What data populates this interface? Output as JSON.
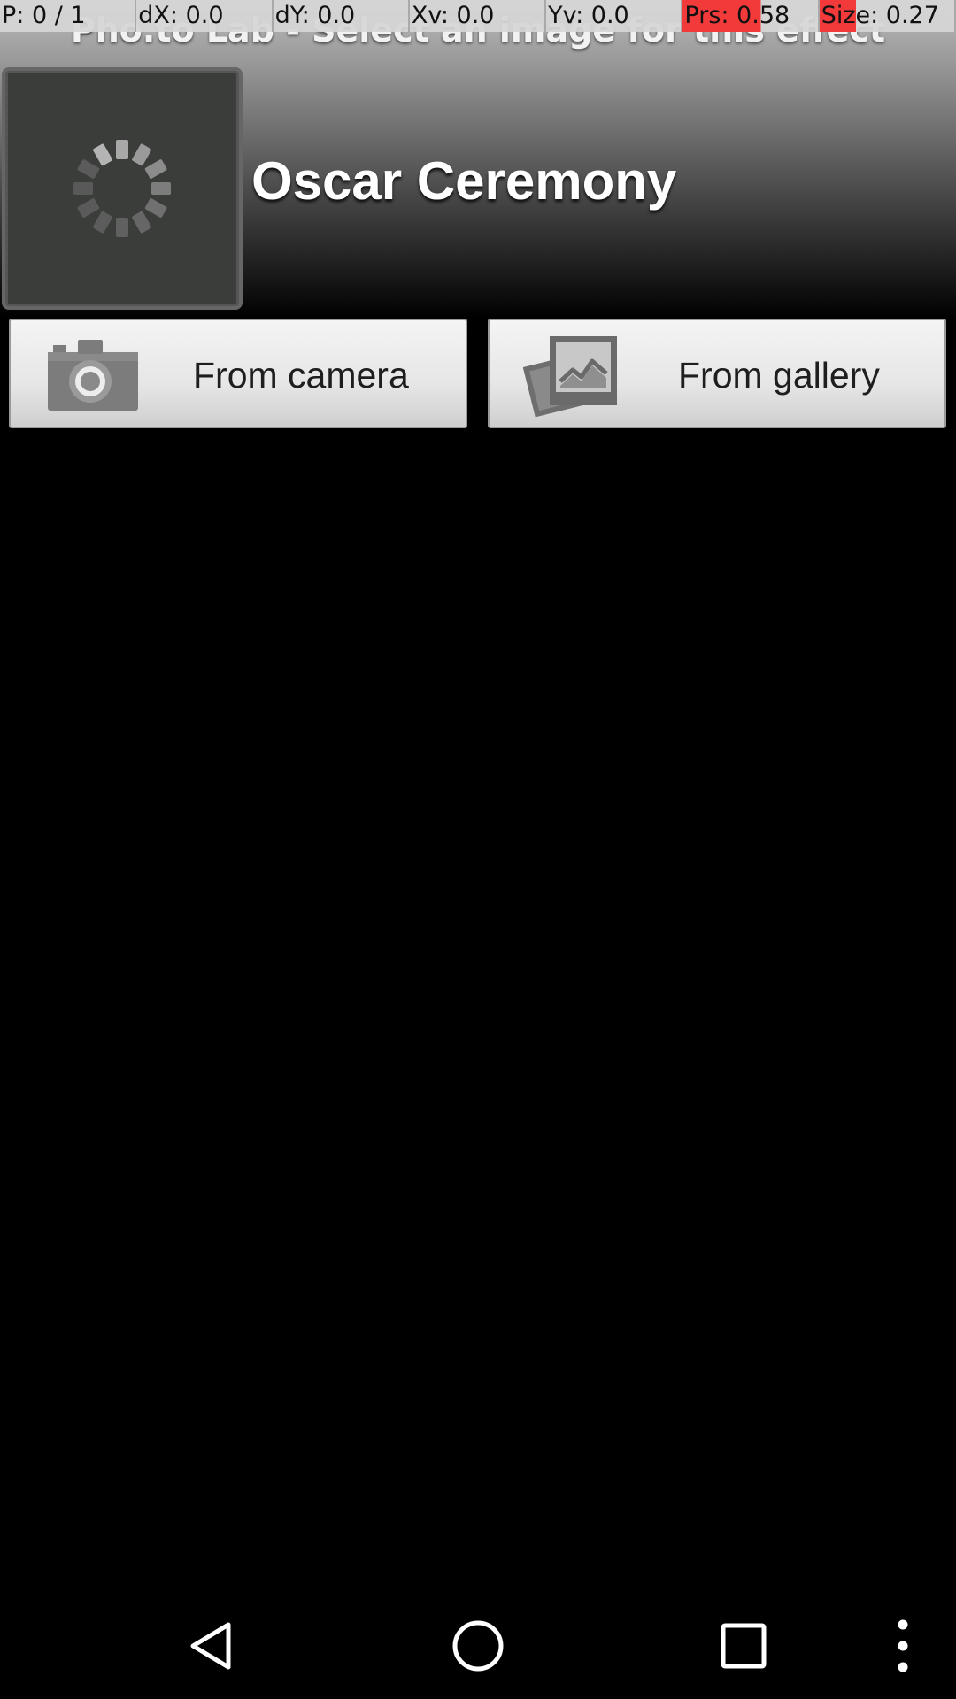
{
  "debug_bar": {
    "cells": [
      {
        "text": "P: 0 / 1"
      },
      {
        "text": "dX: 0.0"
      },
      {
        "text": "dY: 0.0"
      },
      {
        "text": "Xv: 0.0"
      },
      {
        "text": "Yv: 0.0"
      },
      {
        "text": "Prs: 0.58"
      },
      {
        "text": "Size: 0.27"
      }
    ]
  },
  "app_title": "Pho.to Lab - Select an image for this effect",
  "effect": {
    "name": "Oscar Ceremony"
  },
  "buttons": {
    "camera": {
      "label": "From camera",
      "icon": "camera-icon"
    },
    "gallery": {
      "label": "From gallery",
      "icon": "gallery-icon"
    }
  },
  "nav": {
    "back_icon": "back-icon",
    "home_icon": "home-icon",
    "recents_icon": "recents-icon",
    "menu_icon": "overflow-menu-icon"
  },
  "colors": {
    "alert": "#f23a3a",
    "button_face": "#e6e6e6",
    "background": "#000000"
  }
}
